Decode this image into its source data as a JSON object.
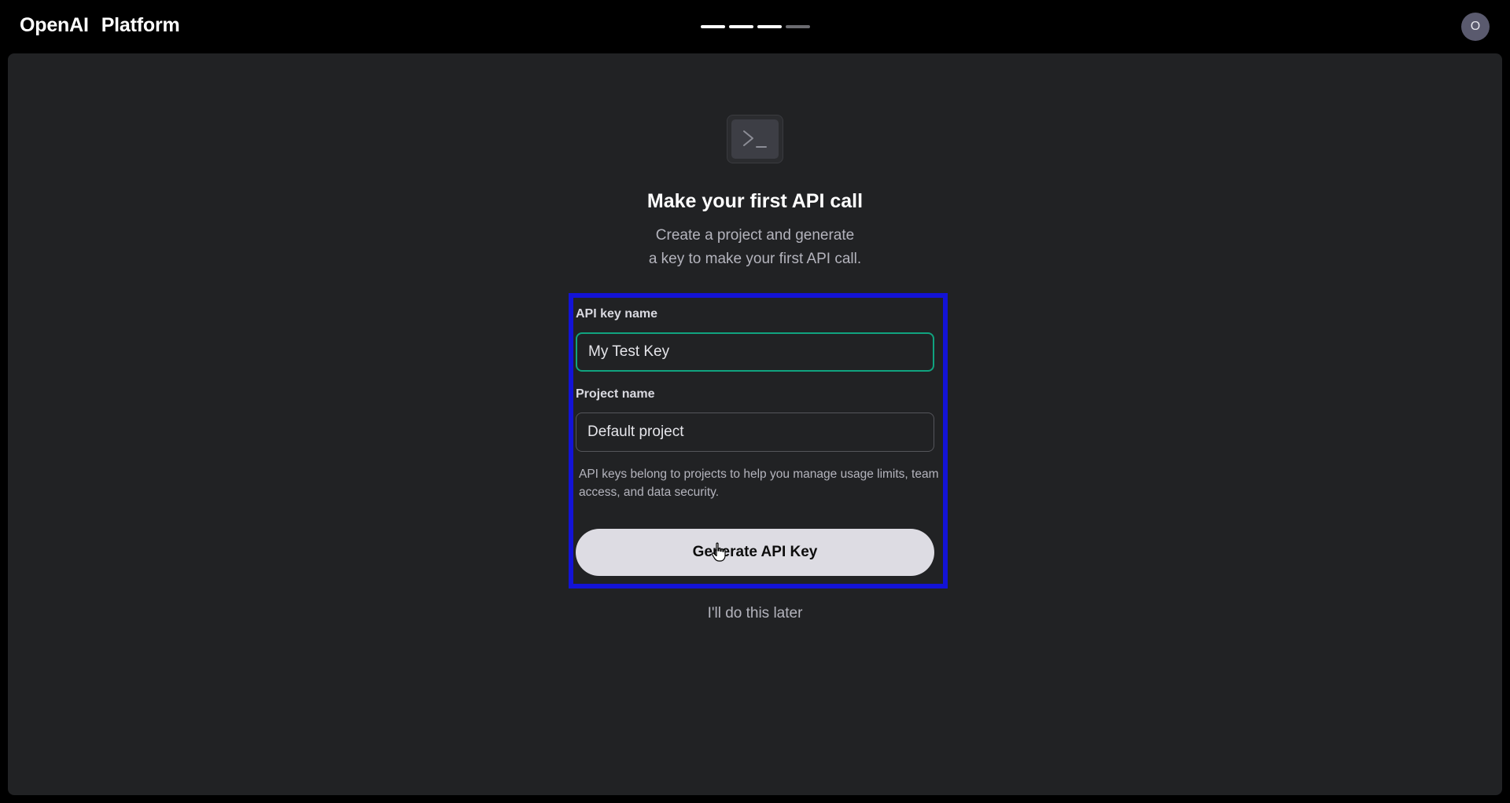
{
  "header": {
    "brand_primary": "OpenAI",
    "brand_secondary": "Platform",
    "steps_total": 4,
    "steps_completed": 3,
    "avatar_initial": "O"
  },
  "onboarding": {
    "icon": "terminal-icon",
    "title": "Make your first API call",
    "subtitle_line1": "Create a project and generate",
    "subtitle_line2": "a key to make your first API call.",
    "form": {
      "api_key_label": "API key name",
      "api_key_value": "My Test Key",
      "project_label": "Project name",
      "project_value": "Default project",
      "help_text": "API keys belong to projects to help you manage usage limits, team access, and data security.",
      "generate_button": "Generate API Key"
    },
    "skip_link": "I'll do this later"
  },
  "colors": {
    "background": "#000000",
    "panel": "#212224",
    "focus_border": "#10a37f",
    "highlight_box": "#1313d6",
    "button": "#dddce3"
  }
}
